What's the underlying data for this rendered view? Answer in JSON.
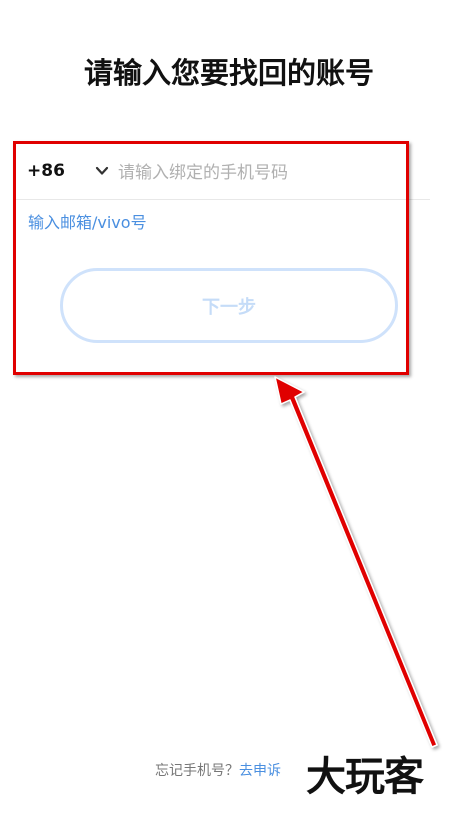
{
  "page": {
    "title": "请输入您要找回的账号"
  },
  "phone": {
    "country_code": "+86",
    "placeholder": "请输入绑定的手机号码",
    "value": ""
  },
  "alt_login": {
    "email_link": "输入邮箱/vivo号"
  },
  "actions": {
    "next_label": "下一步"
  },
  "footer": {
    "forgot_text": "忘记手机号？",
    "appeal_link": "去申诉"
  },
  "watermark": {
    "text": "大玩客"
  },
  "colors": {
    "accent_blue": "#4a8fe0",
    "button_disabled_border": "#cfe2fb",
    "annotation_red": "#e00000"
  }
}
